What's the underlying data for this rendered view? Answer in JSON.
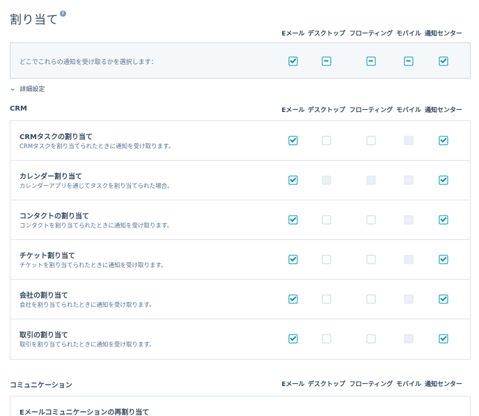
{
  "page": {
    "title": "割り当て",
    "info_icon": "i"
  },
  "columns": [
    "Eメール",
    "デスクトップ",
    "フローティング",
    "モバイル",
    "通知センター"
  ],
  "summary": {
    "text": "どこでこれらの通知を受け取るかを選択します：",
    "states": [
      "checked",
      "indeterminate",
      "indeterminate",
      "indeterminate",
      "checked"
    ]
  },
  "detail_toggle": {
    "label": "詳細設定",
    "icon": "chevron-down-icon"
  },
  "crm": {
    "title": "CRM",
    "rows": [
      {
        "title": "CRMタスクの割り当て",
        "desc": "CRMタスクを割り当てられたときに通知を受け取ります。",
        "states": [
          "checked",
          "unchecked",
          "unchecked",
          "disabled",
          "checked"
        ]
      },
      {
        "title": "カレンダー割り当て",
        "desc": "カレンダーアプリを通じてタスクを割り当てられた場合。",
        "states": [
          "checked",
          "disabled",
          "disabled",
          "disabled",
          "checked"
        ]
      },
      {
        "title": "コンタクトの割り当て",
        "desc": "コンタクトを割り当てられたときに通知を受け取ります。",
        "states": [
          "checked",
          "unchecked",
          "unchecked",
          "disabled",
          "checked"
        ]
      },
      {
        "title": "チケット割り当て",
        "desc": "チケットを割り当てられたときに通知を受け取ります。",
        "states": [
          "checked",
          "unchecked",
          "unchecked",
          "disabled",
          "checked"
        ]
      },
      {
        "title": "会社の割り当て",
        "desc": "会社を割り当てられたときに通知を受け取ります。",
        "states": [
          "checked",
          "unchecked",
          "unchecked",
          "disabled",
          "checked"
        ]
      },
      {
        "title": "取引の割り当て",
        "desc": "取引を割り当てられたときに通知を受け取ります。",
        "states": [
          "checked",
          "unchecked",
          "unchecked",
          "disabled",
          "checked"
        ]
      }
    ]
  },
  "communication": {
    "title": "コミュニケーション",
    "rows": [
      {
        "title": "Eメールコミュニケーションの再割り当て"
      }
    ]
  },
  "colors": {
    "accent": "#0091ae",
    "text": "#33475b",
    "muted": "#516f90",
    "border": "#dfe3eb",
    "panel": "#f5f8fa"
  }
}
